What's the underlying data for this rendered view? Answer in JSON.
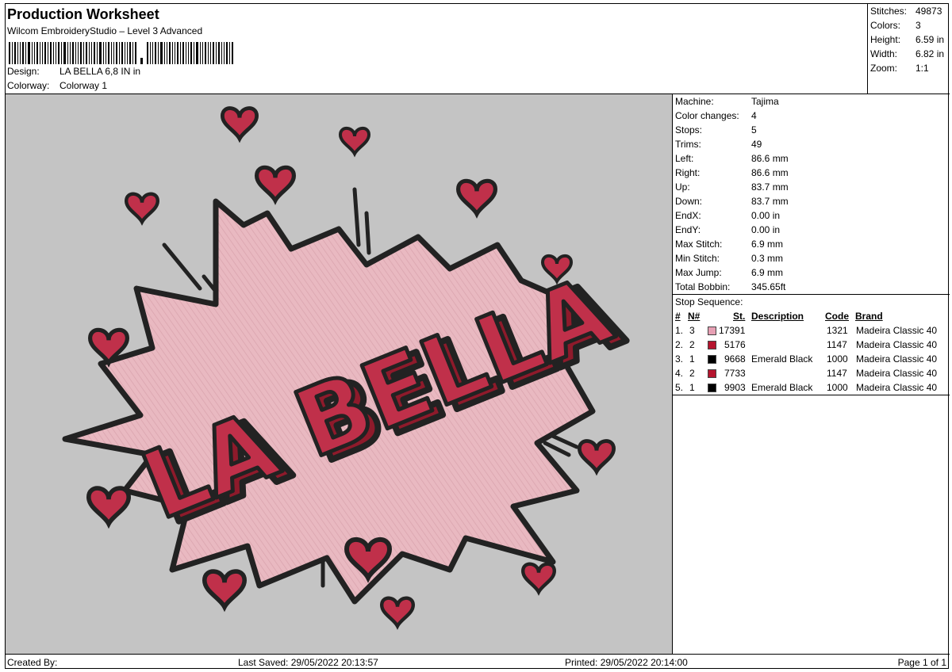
{
  "header": {
    "title": "Production Worksheet",
    "software": "Wilcom EmbroideryStudio – Level 3 Advanced",
    "design_label": "Design:",
    "design_value": "LA BELLA 6,8 IN in",
    "colorway_label": "Colorway:",
    "colorway_value": "Colorway 1"
  },
  "summary": [
    {
      "label": "Stitches:",
      "value": "49873"
    },
    {
      "label": "Colors:",
      "value": "3"
    },
    {
      "label": "Height:",
      "value": "6.59 in"
    },
    {
      "label": "Width:",
      "value": "6.82 in"
    },
    {
      "label": "Zoom:",
      "value": "1:1"
    }
  ],
  "design": {
    "text": "LA BELLA",
    "colors": {
      "background": "#c4c4c4",
      "burst_fill": "#e8b9c0",
      "outline": "#222222",
      "red": "#b8283c",
      "heart": "#c0304a"
    }
  },
  "machine_info": [
    {
      "label": "Machine:",
      "value": "Tajima"
    },
    {
      "label": "Color changes:",
      "value": "4"
    },
    {
      "label": "Stops:",
      "value": "5"
    },
    {
      "label": "Trims:",
      "value": "49"
    },
    {
      "label": "Left:",
      "value": "86.6 mm"
    },
    {
      "label": "Right:",
      "value": "86.6 mm"
    },
    {
      "label": "Up:",
      "value": "83.7 mm"
    },
    {
      "label": "Down:",
      "value": "83.7 mm"
    },
    {
      "label": "EndX:",
      "value": "0.00 in"
    },
    {
      "label": "EndY:",
      "value": "0.00 in"
    },
    {
      "label": "Max Stitch:",
      "value": "6.9 mm"
    },
    {
      "label": "Min Stitch:",
      "value": "0.3 mm"
    },
    {
      "label": "Max Jump:",
      "value": "6.9 mm"
    },
    {
      "label": "Total Bobbin:",
      "value": "345.65ft"
    }
  ],
  "stop_sequence": {
    "title": "Stop Sequence:",
    "headers": {
      "num": "#",
      "n": "N#",
      "st": "St.",
      "description": "Description",
      "code": "Code",
      "brand": "Brand"
    },
    "rows": [
      {
        "num": "1.",
        "n": "3",
        "color": "#e7a0b4",
        "st": "17391",
        "description": "",
        "code": "1321",
        "brand": "Madeira Classic 40"
      },
      {
        "num": "2.",
        "n": "2",
        "color": "#b5142e",
        "st": "5176",
        "description": "",
        "code": "1147",
        "brand": "Madeira Classic 40"
      },
      {
        "num": "3.",
        "n": "1",
        "color": "#000000",
        "st": "9668",
        "description": "Emerald Black",
        "code": "1000",
        "brand": "Madeira Classic 40"
      },
      {
        "num": "4.",
        "n": "2",
        "color": "#b5142e",
        "st": "7733",
        "description": "",
        "code": "1147",
        "brand": "Madeira Classic 40"
      },
      {
        "num": "5.",
        "n": "1",
        "color": "#000000",
        "st": "9903",
        "description": "Emerald Black",
        "code": "1000",
        "brand": "Madeira Classic 40"
      }
    ]
  },
  "footer": {
    "created_by": "Created By:",
    "last_saved": "Last Saved: 29/05/2022 20:13:57",
    "printed": "Printed: 29/05/2022 20:14:00",
    "page": "Page 1 of 1"
  }
}
